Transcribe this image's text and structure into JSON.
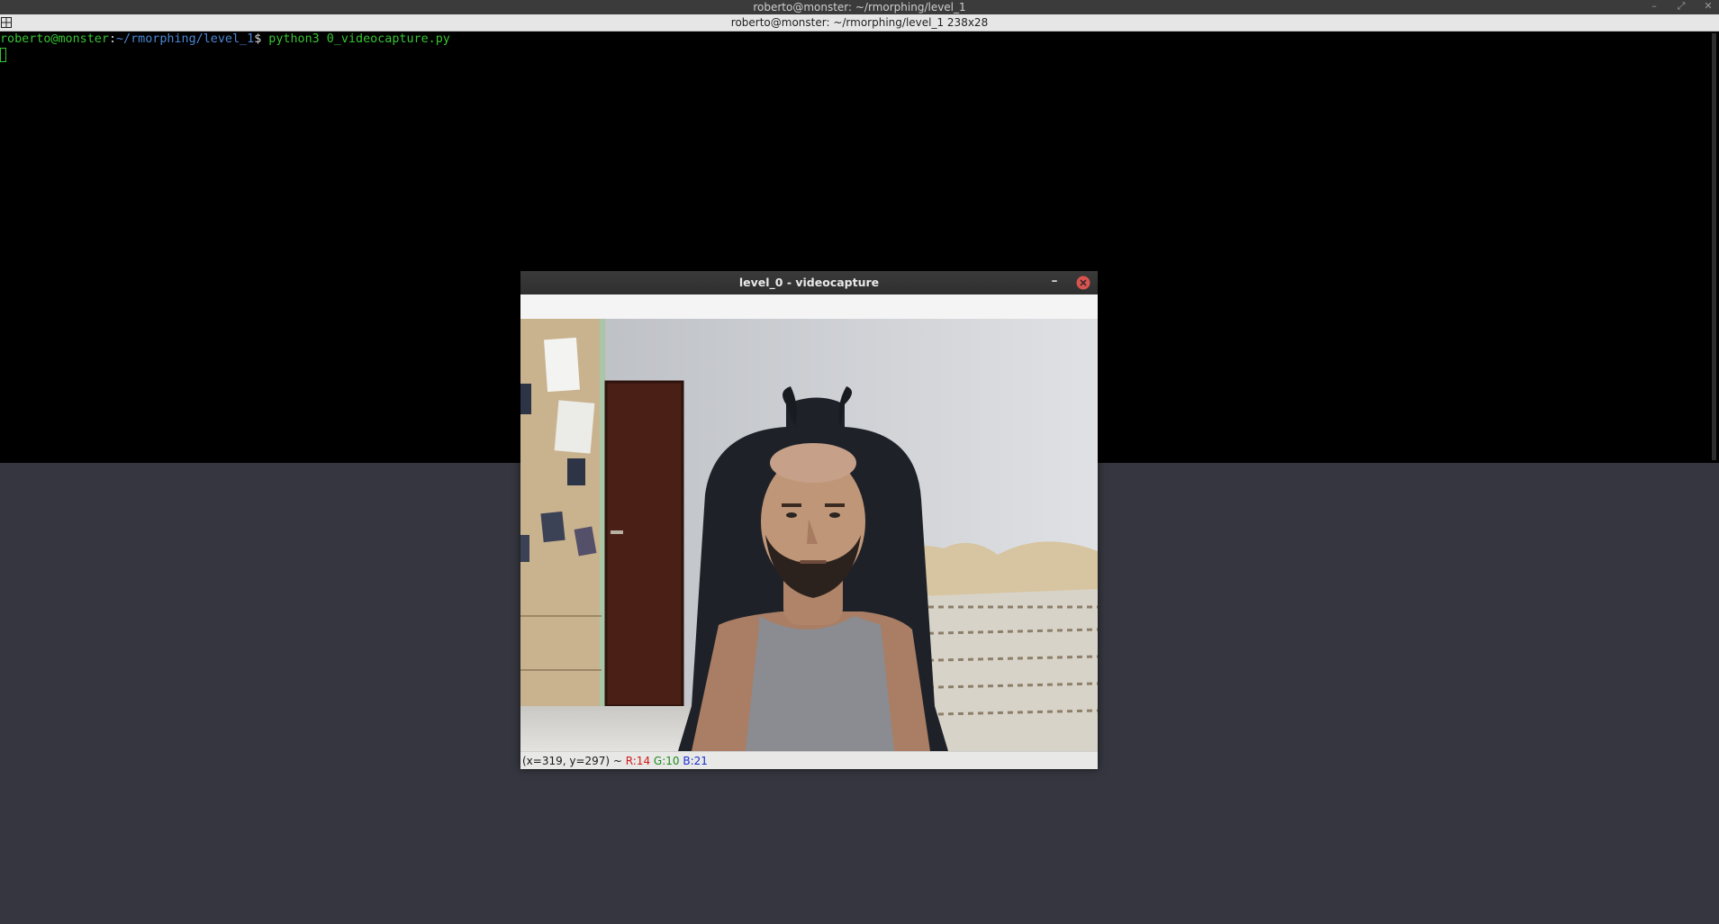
{
  "wm": {
    "title": "roberto@monster: ~/rmorphing/level_1",
    "controls": {
      "minimize": "–",
      "maximize": "⤢",
      "close": "✕"
    }
  },
  "terminal": {
    "tab_title": "roberto@monster: ~/rmorphing/level_1 238x28",
    "prompt_user_host": "roberto@monster",
    "prompt_colon": ":",
    "prompt_path": "~/rmorphing/level_1",
    "prompt_symbol": "$",
    "command": " python3 0_videocapture.py"
  },
  "cv_window": {
    "title": "level_0 - videocapture",
    "minimize_label": "–",
    "status": {
      "coords": "(x=319, y=297) ~ ",
      "r": "R:14",
      "g": "G:10",
      "b": "B:21"
    }
  },
  "colors": {
    "desktop": "#35363f",
    "terminal_bg": "#000000",
    "prompt_green": "#35c430",
    "prompt_blue": "#4c86d4",
    "close_red": "#d9534f"
  }
}
